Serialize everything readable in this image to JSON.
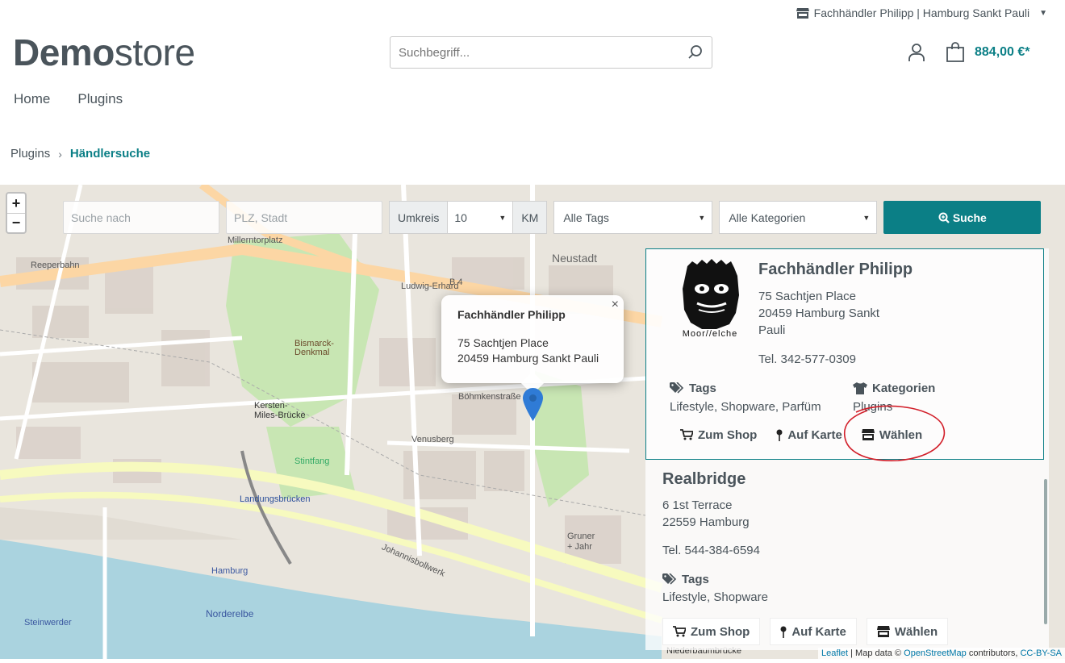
{
  "topbar": {
    "dealer_selection": "Fachhändler Philipp | Hamburg Sankt Pauli"
  },
  "logo": {
    "bold": "Demo",
    "light": "store"
  },
  "search": {
    "placeholder": "Suchbegriff..."
  },
  "cart": {
    "total": "884,00 €*"
  },
  "nav": {
    "items": [
      "Home",
      "Plugins"
    ]
  },
  "breadcrumb": {
    "parent": "Plugins",
    "current": "Händlersuche"
  },
  "filters": {
    "search_placeholder": "Suche nach",
    "zip_placeholder": "PLZ, Stadt",
    "radius_label": "Umkreis",
    "radius_value": "10",
    "radius_unit": "KM",
    "tags_value": "Alle Tags",
    "categories_value": "Alle Kategorien",
    "search_button": "Suche"
  },
  "popup": {
    "name": "Fachhändler Philipp",
    "street": "75 Sachtjen Place",
    "city": "20459 Hamburg Sankt Pauli"
  },
  "dealers": [
    {
      "name": "Fachhändler Philipp",
      "street": "75 Sachtjen Place",
      "city_line1": "20459 Hamburg Sankt",
      "city_line2": "Pauli",
      "tel": "Tel. 342-577-0309",
      "tags_label": "Tags",
      "tags": "Lifestyle, Shopware, Parfüm",
      "categories_label": "Kategorien",
      "categories": "Plugins",
      "logo_text": "Moor//elche",
      "actions": {
        "shop": "Zum Shop",
        "map": "Auf Karte",
        "choose": "Wählen"
      }
    },
    {
      "name": "Realbridge",
      "street": "6 1st Terrace",
      "city": "22559 Hamburg",
      "tel": "Tel. 544-384-6594",
      "tags_label": "Tags",
      "tags": "Lifestyle, Shopware",
      "actions": {
        "shop": "Zum Shop",
        "map": "Auf Karte",
        "choose": "Wählen"
      }
    }
  ],
  "map": {
    "zoom_in": "+",
    "zoom_out": "−",
    "labels": {
      "neustadt": "Neustadt",
      "reeperbahn": "Reeperbahn",
      "millerntorplatz": "Millerntorplatz",
      "ludwig": "Ludwig-Erhard",
      "b4": "B 4",
      "bismarck": "Bismarck-Denkmal",
      "kersten": "Kersten-Miles-Brücke",
      "landungsbruecken": "Landungsbrücken",
      "johannisbollwerk": "Johannisbollwerk",
      "hamburg": "Hamburg",
      "norderelbe": "Norderelbe",
      "steinwerder": "Steinwerder",
      "venusberg": "Venusberg",
      "boehmkenstrasse": "Böhmkenstraße",
      "gruner_jahr": "Gruner + Jahr",
      "niederbaumbruecke": "Niederbaumbrücke",
      "stintfang": "Stintfang"
    },
    "attribution": {
      "leaflet": "Leaflet",
      "mapdata": " | Map data © ",
      "osm": "OpenStreetMap",
      "contrib": " contributors, ",
      "license": "CC-BY-SA"
    }
  },
  "colors": {
    "primary": "#0b7f86",
    "annotation": "#d21f2a",
    "marker": "#2f7bd6"
  }
}
